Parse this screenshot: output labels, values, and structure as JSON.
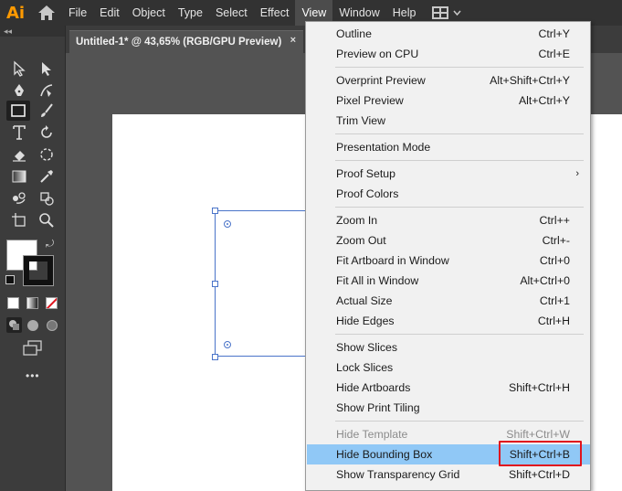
{
  "app": {
    "logo_text": "Ai",
    "brand_color": "#ff9a00"
  },
  "menubar": {
    "items": [
      "File",
      "Edit",
      "Object",
      "Type",
      "Select",
      "Effect",
      "View",
      "Window",
      "Help"
    ],
    "active": "View"
  },
  "document_tab": {
    "title": "Untitled-1* @ 43,65% (RGB/GPU Preview)",
    "close": "×"
  },
  "view_menu": {
    "items": [
      {
        "label": "Outline",
        "shortcut": "Ctrl+Y"
      },
      {
        "label": "Preview on CPU",
        "shortcut": "Ctrl+E"
      },
      {
        "label": "Overprint Preview",
        "shortcut": "Alt+Shift+Ctrl+Y"
      },
      {
        "label": "Pixel Preview",
        "shortcut": "Alt+Ctrl+Y"
      },
      {
        "label": "Trim View",
        "shortcut": ""
      },
      {
        "label": "Presentation Mode",
        "shortcut": ""
      },
      {
        "label": "Proof Setup",
        "shortcut": ""
      },
      {
        "label": "Proof Colors",
        "shortcut": ""
      },
      {
        "label": "Zoom In",
        "shortcut": "Ctrl++"
      },
      {
        "label": "Zoom Out",
        "shortcut": "Ctrl+-"
      },
      {
        "label": "Fit Artboard in Window",
        "shortcut": "Ctrl+0"
      },
      {
        "label": "Fit All in Window",
        "shortcut": "Alt+Ctrl+0"
      },
      {
        "label": "Actual Size",
        "shortcut": "Ctrl+1"
      },
      {
        "label": "Hide Edges",
        "shortcut": "Ctrl+H"
      },
      {
        "label": "Show Slices",
        "shortcut": ""
      },
      {
        "label": "Lock Slices",
        "shortcut": ""
      },
      {
        "label": "Hide Artboards",
        "shortcut": "Shift+Ctrl+H"
      },
      {
        "label": "Show Print Tiling",
        "shortcut": ""
      },
      {
        "label": "Hide Template",
        "shortcut": "Shift+Ctrl+W"
      },
      {
        "label": "Hide Bounding Box",
        "shortcut": "Shift+Ctrl+B"
      },
      {
        "label": "Show Transparency Grid",
        "shortcut": "Shift+Ctrl+D"
      }
    ],
    "highlighted": "Hide Bounding Box",
    "disabled": [
      "Hide Template"
    ],
    "highlight_color": "#90c8f6",
    "callout_color": "#e0141e"
  },
  "toolbar": {
    "more_tools": "•••"
  }
}
